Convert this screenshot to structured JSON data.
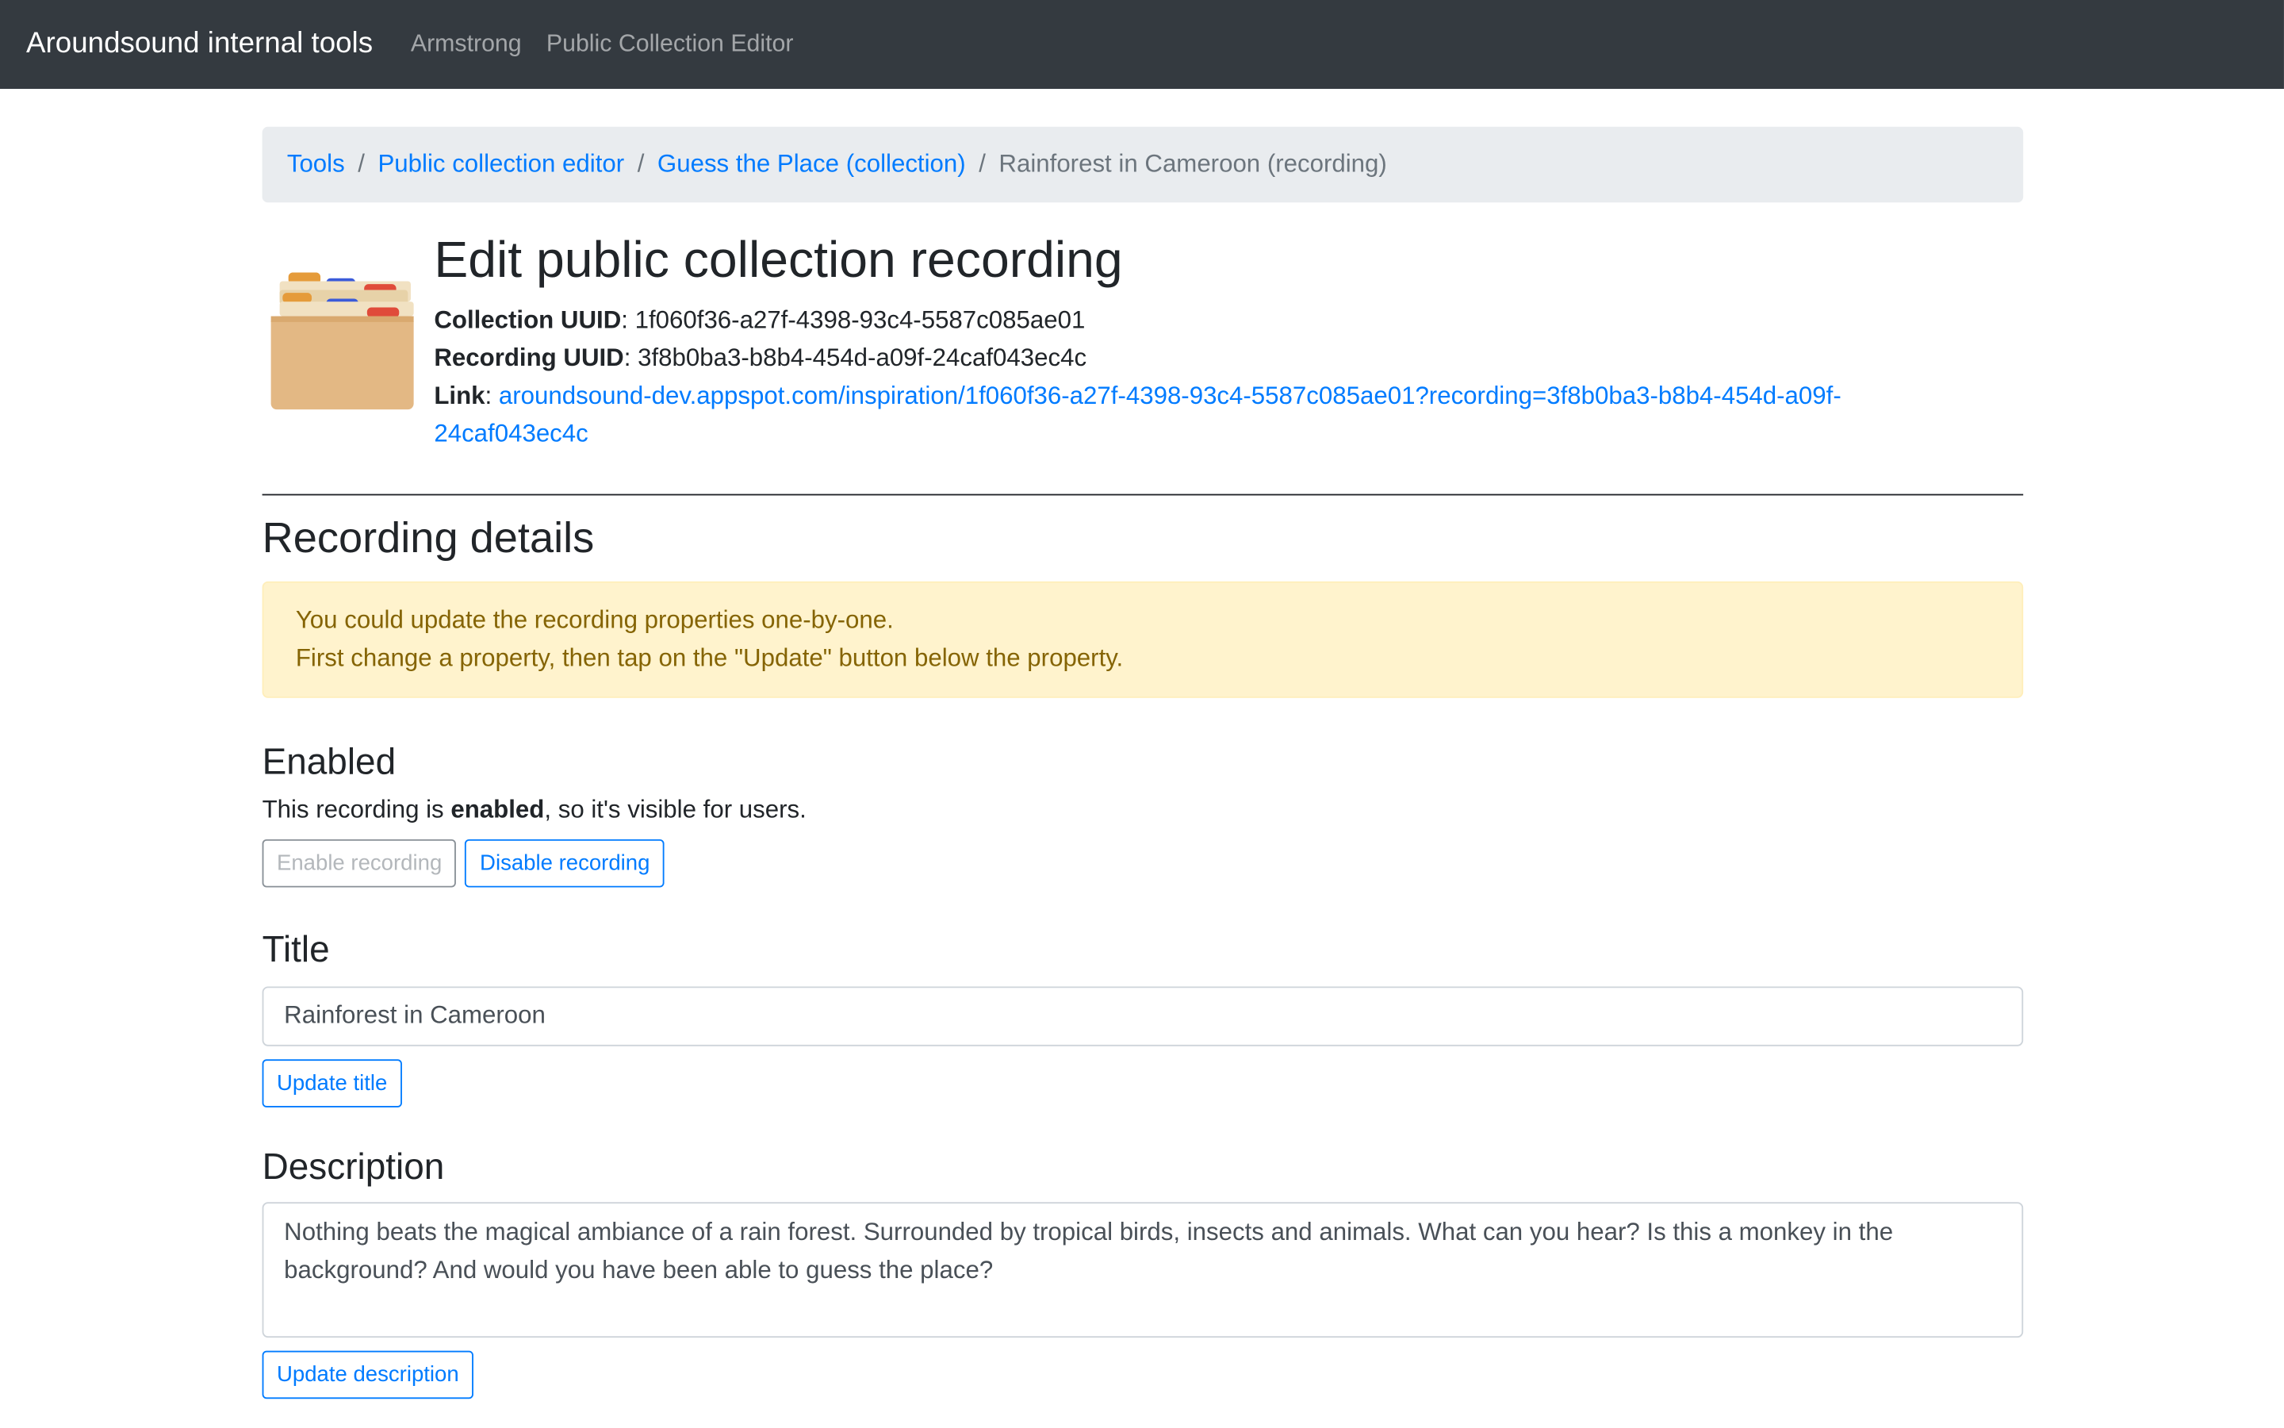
{
  "navbar": {
    "brand": "Aroundsound internal tools",
    "links": [
      "Armstrong",
      "Public Collection Editor"
    ]
  },
  "breadcrumb": {
    "items": [
      "Tools",
      "Public collection editor",
      "Guess the Place (collection)"
    ],
    "active": "Rainforest in Cameroon (recording)",
    "separator": "/"
  },
  "header": {
    "title": "Edit public collection recording",
    "icon": "card-file-box-icon",
    "collection_uuid_label": "Collection UUID",
    "collection_uuid": "1f060f36-a27f-4398-93c4-5587c085ae01",
    "recording_uuid_label": "Recording UUID",
    "recording_uuid": "3f8b0ba3-b8b4-454d-a09f-24caf043ec4c",
    "link_label": "Link",
    "link_line1": "aroundsound-dev.appspot.com/inspiration/1f060f36-a27f-4398-93c4-5587c085ae01?recording=3f8b0ba3-b8b4-454d-a09f-",
    "link_line2": "24caf043ec4c"
  },
  "details": {
    "heading": "Recording details",
    "alert_line1": "You could update the recording properties one-by-one.",
    "alert_line2": "First change a property, then tap on the \"Update\" button below the property."
  },
  "enabled": {
    "heading": "Enabled",
    "text_prefix": "This recording is ",
    "text_status": "enabled",
    "text_suffix": ", so it's visible for users.",
    "enable_label": "Enable recording",
    "disable_label": "Disable recording"
  },
  "title_section": {
    "heading": "Title",
    "value": "Rainforest in Cameroon",
    "update_label": "Update title"
  },
  "description_section": {
    "heading": "Description",
    "value": "Nothing beats the magical ambiance of a rain forest. Surrounded by tropical birds, insects and animals. What can you hear? Is this a monkey in the background? And would you have been able to guess the place?",
    "update_label": "Update description"
  },
  "colors": {
    "navbar": "#343a40",
    "link": "#007bff",
    "alert_bg": "#fff3cd",
    "alert_text": "#856404"
  }
}
